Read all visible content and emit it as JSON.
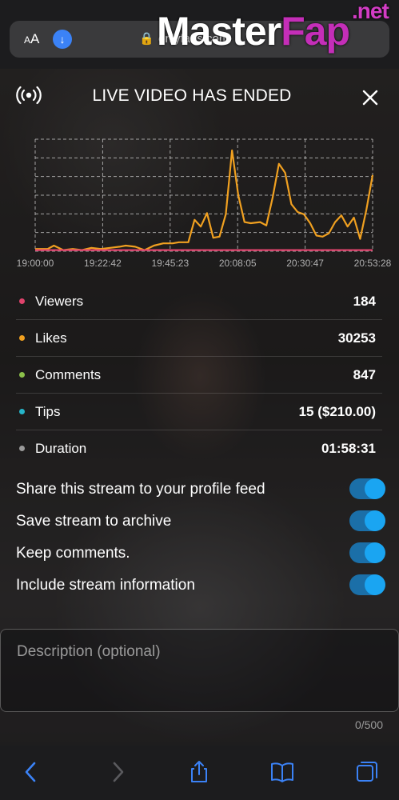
{
  "browser": {
    "aa_label": "AA",
    "url": "onlyfans.com",
    "watermark": {
      "master": "Master",
      "fap": "Fap",
      "net": ".net"
    }
  },
  "header": {
    "title": "LIVE VIDEO HAS ENDED",
    "live_icon": "broadcast-icon",
    "close_icon": "close-icon"
  },
  "chart_data": {
    "type": "line",
    "x": [
      "19:00:00",
      "19:22:42",
      "19:45:23",
      "20:08:05",
      "20:30:47",
      "20:53:28"
    ],
    "x_positions": [
      0,
      0.2,
      0.4,
      0.6,
      0.8,
      1.0
    ],
    "ylim": [
      0,
      1
    ],
    "grid": true,
    "series": [
      {
        "color": "#f0a020",
        "points": [
          [
            0.0,
            0.02
          ],
          [
            0.04,
            0.02
          ],
          [
            0.06,
            0.05
          ],
          [
            0.09,
            0.01
          ],
          [
            0.12,
            0.02
          ],
          [
            0.15,
            0.01
          ],
          [
            0.18,
            0.03
          ],
          [
            0.21,
            0.02
          ],
          [
            0.24,
            0.03
          ],
          [
            0.27,
            0.04
          ],
          [
            0.29,
            0.05
          ],
          [
            0.32,
            0.04
          ],
          [
            0.35,
            0.01
          ],
          [
            0.38,
            0.05
          ],
          [
            0.41,
            0.07
          ],
          [
            0.44,
            0.07
          ],
          [
            0.46,
            0.08
          ],
          [
            0.49,
            0.08
          ],
          [
            0.51,
            0.28
          ],
          [
            0.53,
            0.22
          ],
          [
            0.55,
            0.34
          ],
          [
            0.57,
            0.12
          ],
          [
            0.59,
            0.13
          ],
          [
            0.61,
            0.33
          ],
          [
            0.63,
            0.9
          ],
          [
            0.65,
            0.5
          ],
          [
            0.67,
            0.26
          ],
          [
            0.69,
            0.25
          ],
          [
            0.72,
            0.26
          ],
          [
            0.74,
            0.23
          ],
          [
            0.76,
            0.48
          ],
          [
            0.78,
            0.78
          ],
          [
            0.8,
            0.7
          ],
          [
            0.82,
            0.42
          ],
          [
            0.84,
            0.35
          ],
          [
            0.86,
            0.33
          ],
          [
            0.88,
            0.25
          ],
          [
            0.9,
            0.14
          ],
          [
            0.92,
            0.13
          ],
          [
            0.94,
            0.16
          ],
          [
            0.96,
            0.26
          ],
          [
            0.98,
            0.32
          ],
          [
            1.0,
            0.22
          ],
          [
            1.02,
            0.3
          ],
          [
            1.04,
            0.11
          ],
          [
            1.06,
            0.37
          ],
          [
            1.08,
            0.68
          ]
        ]
      },
      {
        "color": "#e0436c",
        "points": [
          [
            0.0,
            0.01
          ],
          [
            1.08,
            0.01
          ]
        ]
      }
    ]
  },
  "stats": [
    {
      "label": "Viewers",
      "value": "184",
      "color": "#e0436c"
    },
    {
      "label": "Likes",
      "value": "30253",
      "color": "#f0a020"
    },
    {
      "label": "Comments",
      "value": "847",
      "color": "#8cc04a"
    },
    {
      "label": "Tips",
      "value": "15 ($210.00)",
      "color": "#26b5c9"
    },
    {
      "label": "Duration",
      "value": "01:58:31",
      "color": "#9a9a9a"
    }
  ],
  "toggles": [
    {
      "label": "Share this stream to your profile feed",
      "on": true
    },
    {
      "label": "Save stream to archive",
      "on": true
    },
    {
      "label": "Keep comments.",
      "on": true
    },
    {
      "label": "Include stream information",
      "on": true
    }
  ],
  "description": {
    "placeholder": "Description (optional)",
    "counter": "0/500"
  },
  "toolbar": {
    "back_icon": "chevron-left-icon",
    "forward_icon": "chevron-right-icon",
    "share_icon": "share-icon",
    "bookmarks_icon": "book-icon",
    "tabs_icon": "tabs-icon"
  }
}
